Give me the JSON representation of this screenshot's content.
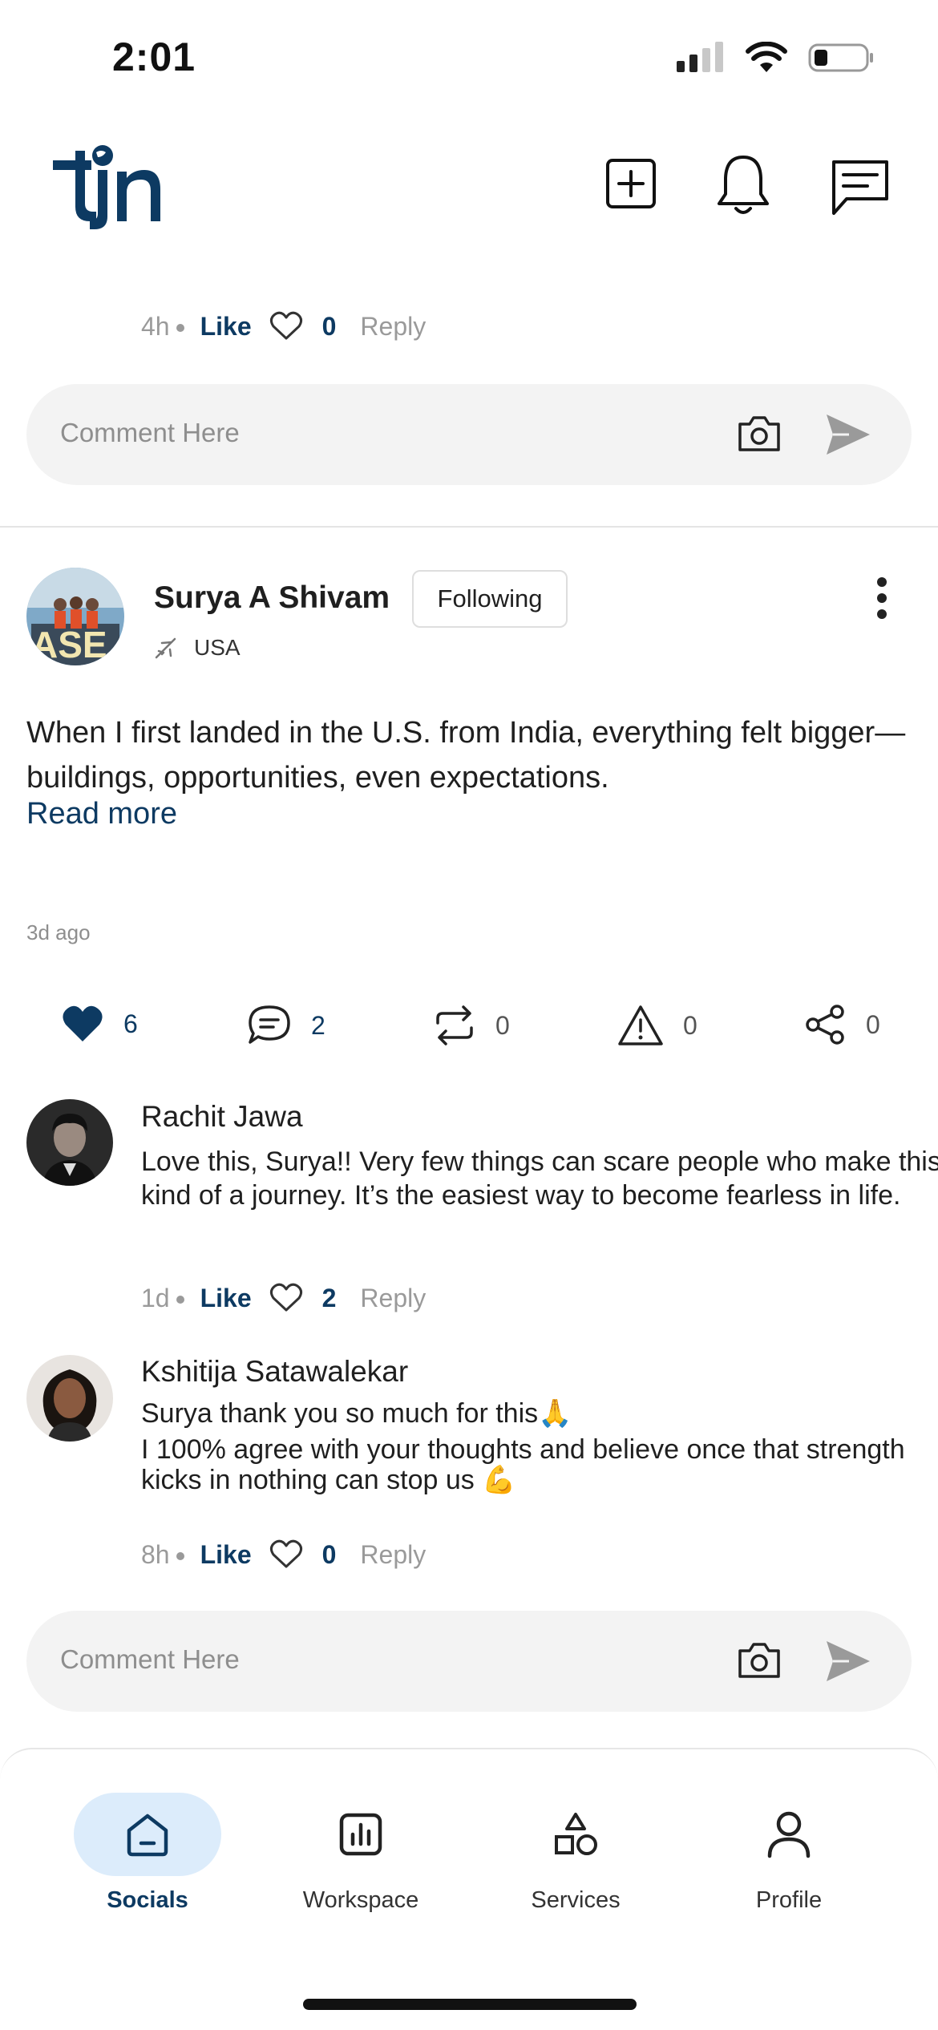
{
  "status_bar": {
    "time": "2:01"
  },
  "prev_comment": {
    "time": "4h",
    "like_label": "Like",
    "like_count": "0",
    "reply_label": "Reply"
  },
  "comment_box_1": {
    "placeholder": "Comment Here"
  },
  "post": {
    "author": "Surya A Shivam",
    "follow_label": "Following",
    "location": "USA",
    "text": "When I first landed in the U.S. from India, everything felt bigger—buildings, opportunities, even expectations.",
    "read_more": "Read more",
    "time": "3d ago",
    "actions": {
      "likes": "6",
      "comments": "2",
      "reposts": "0",
      "reports": "0",
      "shares": "0"
    }
  },
  "comments": [
    {
      "name": "Rachit Jawa",
      "text": "Love this, Surya!! Very few things can scare people who make this kind of a journey. It’s the easiest way to become fearless in life.",
      "time": "1d",
      "like_label": "Like",
      "like_count": "2",
      "reply_label": "Reply"
    },
    {
      "name": "Kshitija Satawalekar",
      "text_line1": "Surya thank you so much for this🙏",
      "text_line2": "I 100% agree with your thoughts and believe once that strength kicks in nothing can stop us 💪",
      "time": "8h",
      "like_label": "Like",
      "like_count": "0",
      "reply_label": "Reply"
    }
  ],
  "comment_box_2": {
    "placeholder": "Comment Here"
  },
  "bottom_nav": [
    {
      "label": "Socials",
      "icon": "home-icon",
      "active": true
    },
    {
      "label": "Workspace",
      "icon": "chart-icon",
      "active": false
    },
    {
      "label": "Services",
      "icon": "shapes-icon",
      "active": false
    },
    {
      "label": "Profile",
      "icon": "person-icon",
      "active": false
    }
  ],
  "colors": {
    "brand": "#0d3a62",
    "active_nav_bg": "#dcecfb"
  }
}
